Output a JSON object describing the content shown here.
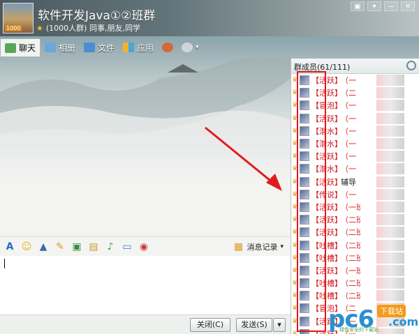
{
  "header": {
    "title": "软件开发Java①②班群",
    "subtitle": "(1000人群) 同事,朋友,同学",
    "avatar_tag": "1000"
  },
  "window_controls": [
    "▣",
    "▾",
    "—",
    "✕"
  ],
  "toolbar": {
    "tabs": [
      {
        "label": "聊天",
        "icon": "chat-icon"
      },
      {
        "label": "相册",
        "icon": "album-icon"
      },
      {
        "label": "文件",
        "icon": "folder-icon"
      },
      {
        "label": "应用",
        "icon": "apps-icon"
      }
    ],
    "add_member_icon": "add-user-icon",
    "settings_icon": "gear-icon"
  },
  "format_bar": {
    "icons": [
      "font-icon",
      "smiley-icon",
      "shake-icon",
      "note-icon",
      "image-icon",
      "doc-icon",
      "music-icon",
      "screen-icon",
      "video-icon"
    ],
    "history_label": "消息记录"
  },
  "bottom": {
    "close_label": "关闭(C)",
    "send_label": "发送(S)"
  },
  "members": {
    "header": "群成员(61/111)",
    "list": [
      {
        "tag": "【活跃】",
        "name": "（一",
        "black": false
      },
      {
        "tag": "【活跃】",
        "name": "（二",
        "black": false
      },
      {
        "tag": "【冒泡】",
        "name": "（一",
        "black": false
      },
      {
        "tag": "【活跃】",
        "name": "（一",
        "black": false
      },
      {
        "tag": "【潜水】",
        "name": "（一",
        "black": false
      },
      {
        "tag": "【潜水】",
        "name": "（一",
        "black": false
      },
      {
        "tag": "【活跃】",
        "name": "（一",
        "black": false
      },
      {
        "tag": "【潜水】",
        "name": "（一",
        "black": false
      },
      {
        "tag": "【活跃】",
        "name": "辅导",
        "black": true
      },
      {
        "tag": "【传说】",
        "name": "（一",
        "black": false
      },
      {
        "tag": "【活跃】",
        "name": "（一班",
        "black": false
      },
      {
        "tag": "【活跃】",
        "name": "（二班",
        "black": false
      },
      {
        "tag": "【活跃】",
        "name": "（二班",
        "black": false
      },
      {
        "tag": "【吐槽】",
        "name": "（二班",
        "black": false
      },
      {
        "tag": "【吐槽】",
        "name": "（二班",
        "black": false
      },
      {
        "tag": "【活跃】",
        "name": "（一班",
        "black": false
      },
      {
        "tag": "【吐槽】",
        "name": "（二班",
        "black": false
      },
      {
        "tag": "【吐槽】",
        "name": "（二班",
        "black": false
      },
      {
        "tag": "【冒泡】",
        "name": "（二",
        "black": false
      },
      {
        "tag": "【活跃】",
        "name": "（一",
        "black": false
      },
      {
        "tag": "【活跃】",
        "name": "（一",
        "black": false
      }
    ]
  },
  "watermark": {
    "brand": "pc6",
    "tag": "下载站",
    "com": ".com",
    "slogan": "绿色安全的下载站"
  }
}
